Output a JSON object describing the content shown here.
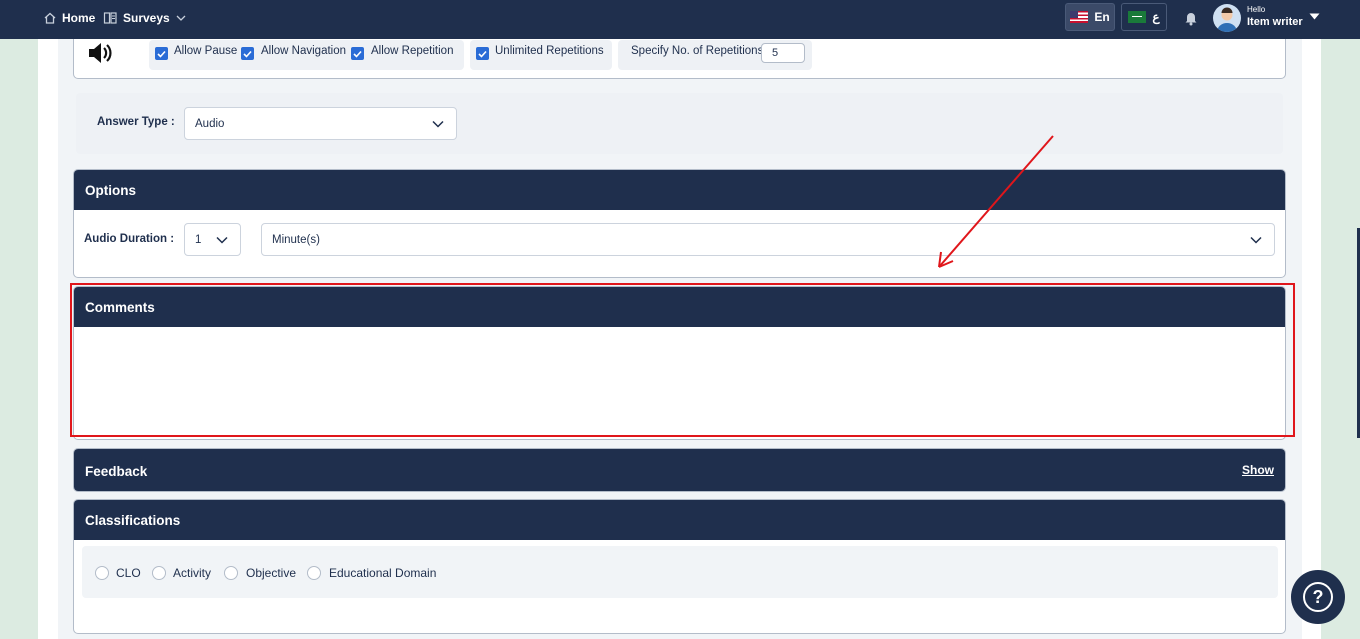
{
  "nav": {
    "home": "Home",
    "surveys": "Surveys"
  },
  "lang": {
    "en": "En",
    "ar": "ع"
  },
  "user": {
    "hello": "Hello",
    "name": "Item writer"
  },
  "media": {
    "options": [
      "Allow Pause",
      "Allow Navigation",
      "Allow Repetition",
      "Unlimited Repetitions"
    ],
    "reps_label": "Specify No. of Repetitions",
    "reps_value": "5"
  },
  "answer": {
    "label": "Answer Type :",
    "value": "Audio"
  },
  "options_card": {
    "title": "Options",
    "duration_label": "Audio Duration :",
    "duration_value": "1",
    "unit_value": "Minute(s)"
  },
  "comments": {
    "title": "Comments"
  },
  "feedback": {
    "title": "Feedback",
    "show": "Show"
  },
  "classifications": {
    "title": "Classifications",
    "items": [
      "CLO",
      "Activity",
      "Objective",
      "Educational Domain"
    ]
  },
  "colors": {
    "navy": "#1f2f4d",
    "accent": "#2a6cd6",
    "highlight": "#e0161b"
  }
}
